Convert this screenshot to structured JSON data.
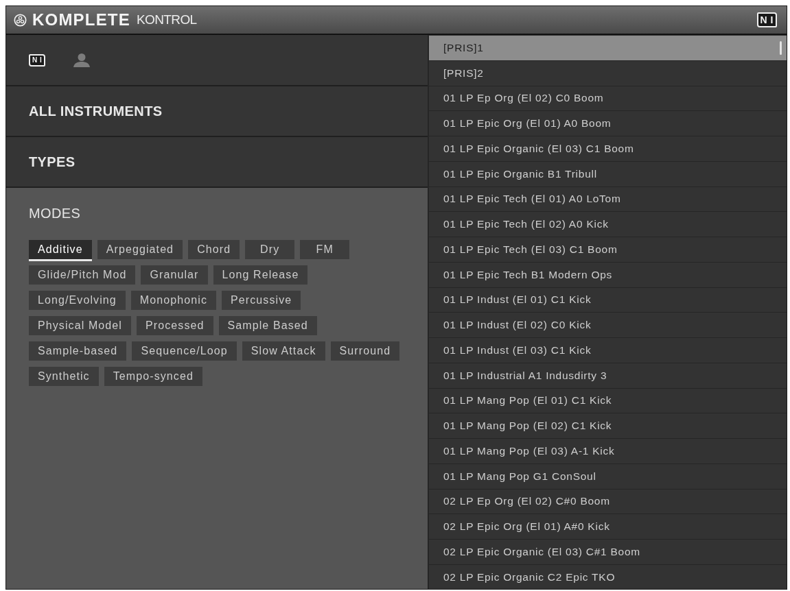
{
  "window": {
    "title_bold": "KOMPLETE",
    "title_light": "KONTROL",
    "brand_logo": "N I"
  },
  "library_filter": [
    {
      "kind": "factory",
      "label": "N I",
      "selected": true
    },
    {
      "kind": "user",
      "selected": false
    }
  ],
  "sections": [
    {
      "label": "ALL INSTRUMENTS",
      "expanded": false
    },
    {
      "label": "TYPES",
      "expanded": false
    },
    {
      "label": "MODES",
      "expanded": true,
      "tags": [
        {
          "label": "Additive",
          "selected": true
        },
        {
          "label": "Arpeggiated",
          "selected": false
        },
        {
          "label": "Chord",
          "selected": false
        },
        {
          "label": "Dry",
          "selected": false
        },
        {
          "label": "FM",
          "selected": false
        },
        {
          "label": "Glide/Pitch Mod",
          "selected": false
        },
        {
          "label": "Granular",
          "selected": false
        },
        {
          "label": "Long Release",
          "selected": false
        },
        {
          "label": "Long/Evolving",
          "selected": false
        },
        {
          "label": "Monophonic",
          "selected": false
        },
        {
          "label": "Percussive",
          "selected": false
        },
        {
          "label": "Physical Model",
          "selected": false
        },
        {
          "label": "Processed",
          "selected": false
        },
        {
          "label": "Sample Based",
          "selected": false
        },
        {
          "label": "Sample-based",
          "selected": false
        },
        {
          "label": "Sequence/Loop",
          "selected": false
        },
        {
          "label": "Slow Attack",
          "selected": false
        },
        {
          "label": "Surround",
          "selected": false
        },
        {
          "label": "Synthetic",
          "selected": false
        },
        {
          "label": "Tempo-synced",
          "selected": false
        }
      ]
    }
  ],
  "presets": [
    {
      "name": "[PRIS]1",
      "selected": true
    },
    {
      "name": "[PRIS]2",
      "selected": false
    },
    {
      "name": "01 LP Ep Org (El 02) C0 Boom",
      "selected": false
    },
    {
      "name": "01 LP Epic Org (El 01) A0 Boom",
      "selected": false
    },
    {
      "name": "01 LP Epic Organic (El 03) C1 Boom",
      "selected": false
    },
    {
      "name": "01 LP Epic Organic B1 Tribull",
      "selected": false
    },
    {
      "name": "01 LP Epic Tech (El 01) A0 LoTom",
      "selected": false
    },
    {
      "name": "01 LP Epic Tech (El 02) A0 Kick",
      "selected": false
    },
    {
      "name": "01 LP Epic Tech (El 03) C1 Boom",
      "selected": false
    },
    {
      "name": "01 LP Epic Tech B1 Modern Ops",
      "selected": false
    },
    {
      "name": "01 LP Indust (El 01) C1 Kick",
      "selected": false
    },
    {
      "name": "01 LP Indust (El 02) C0 Kick",
      "selected": false
    },
    {
      "name": "01 LP Indust (El 03) C1 Kick",
      "selected": false
    },
    {
      "name": "01 LP Industrial A1 Indusdirty 3",
      "selected": false
    },
    {
      "name": "01 LP Mang Pop (El 01) C1 Kick",
      "selected": false
    },
    {
      "name": "01 LP Mang Pop (El 02) C1 Kick",
      "selected": false
    },
    {
      "name": "01 LP Mang Pop (El 03) A-1 Kick",
      "selected": false
    },
    {
      "name": "01 LP Mang Pop G1 ConSoul",
      "selected": false
    },
    {
      "name": "02 LP Ep Org (El 02) C#0 Boom",
      "selected": false
    },
    {
      "name": "02 LP Epic Org (El 01) A#0 Kick",
      "selected": false
    },
    {
      "name": "02 LP Epic Organic (El 03) C#1 Boom",
      "selected": false
    },
    {
      "name": "02 LP Epic Organic C2 Epic TKO",
      "selected": false
    }
  ]
}
